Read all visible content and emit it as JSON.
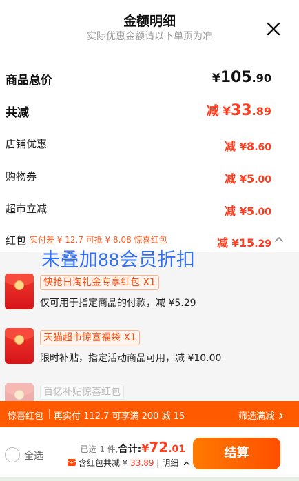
{
  "header": {
    "title": "金额明细",
    "subtitle": "实际优惠金额请以下单页为准"
  },
  "rows": {
    "total": {
      "label": "商品总价",
      "yen": "¥",
      "int": "105",
      "dec": ".90"
    },
    "reduced": {
      "label": "共减",
      "prefix": "减",
      "yen": "¥",
      "int": "33",
      "dec": ".89"
    },
    "shop": {
      "label": "店铺优惠",
      "prefix": "减",
      "yen": "¥",
      "int": "8",
      "dec": ".60"
    },
    "coupon": {
      "label": "购物券",
      "prefix": "减",
      "yen": "¥",
      "int": "5",
      "dec": ".00"
    },
    "market": {
      "label": "超市立减",
      "prefix": "减",
      "yen": "¥",
      "int": "5",
      "dec": ".00"
    },
    "redpacket": {
      "label": "红包",
      "note": "实付差 ¥ 12.7 可抵 ¥ 8.08 惊喜红包",
      "prefix": "减",
      "yen": "¥",
      "int": "15",
      "dec": ".29"
    }
  },
  "watermark": "未叠加88会员折扣",
  "packets": [
    {
      "tag": "快抢日淘礼金专享红包 X1",
      "desc": "仅可用于指定商品的付款，减 ¥5.29"
    },
    {
      "tag": "天猫超市惊喜福袋 X1",
      "desc": "限时补贴，指定活动商品可用，减 ¥10.00"
    },
    {
      "tag": "百亿补贴惊喜红包",
      "desc": ""
    }
  ],
  "banner": {
    "title": "惊喜红包",
    "text": "再实付 112.7 可享满 200 减 15",
    "link": "筛选满减"
  },
  "footer": {
    "select_all": "全选",
    "selected_count": "已选 1 件,",
    "total_label": "合计:",
    "yen": "¥",
    "total_int": "72",
    "total_dec": ".01",
    "subline_text": "含红包共减 ¥ ",
    "subline_amount": "33.89",
    "subline_detail": " | 明细",
    "checkout": "结算"
  },
  "colors": {
    "accent": "#ff3c1e",
    "banner": "#ff5a00",
    "watermark": "#2f6ff5"
  }
}
